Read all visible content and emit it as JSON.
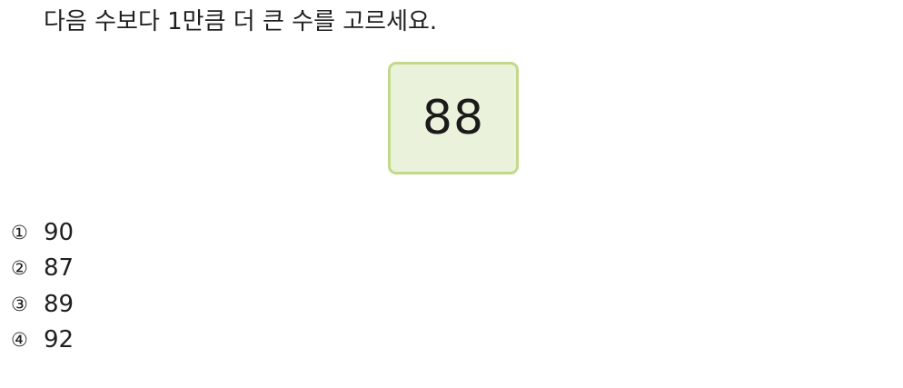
{
  "question": {
    "text": "다음 수보다 1만큼 더 큰 수를 고르세요."
  },
  "card": {
    "value": "88",
    "border_color": "#c2d98a",
    "background_color": "#ebf2db"
  },
  "options": [
    {
      "marker": "①",
      "text": "90"
    },
    {
      "marker": "②",
      "text": "87"
    },
    {
      "marker": "③",
      "text": "89"
    },
    {
      "marker": "④",
      "text": "92"
    }
  ]
}
